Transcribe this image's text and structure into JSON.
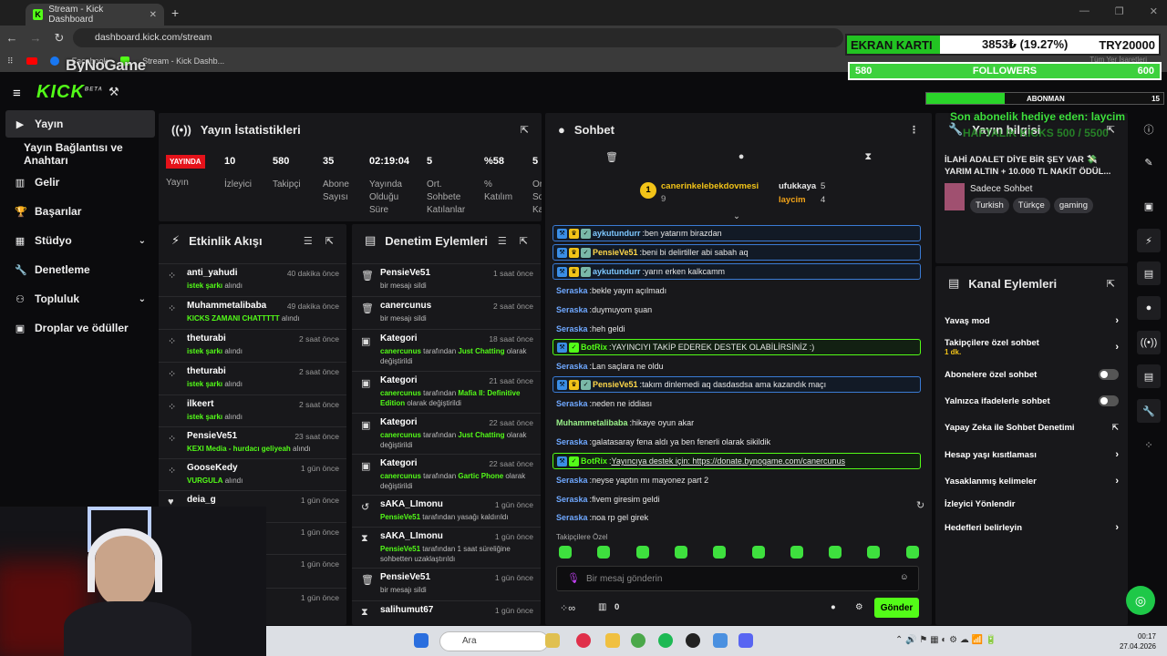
{
  "browser": {
    "tab_title": "Stream - Kick Dashboard",
    "url": "dashboard.kick.com/stream",
    "bookmarks": [
      "Facebook",
      "Stream - Kick Dashb..."
    ],
    "all_bookmarks": "Tüm Yer İşaretleri"
  },
  "overlay": {
    "logo": "ByNoGame",
    "ekran_label": "EKRAN KARTI",
    "ekran_value": "3853₺ (19.27%)",
    "ekran_goal": "TRY20000",
    "followers_left": "580",
    "followers_label": "FOLLOWERS",
    "followers_right": "600",
    "followers_progress": 0.97,
    "abonman_label": "ABONMAN",
    "abonman_value": "15",
    "last_sub": "Son abonelik hediye eden: laycim",
    "weekly": "HAFTALIK KICKS 500 / 5500"
  },
  "nav": {
    "items": [
      {
        "label": "Yayın"
      },
      {
        "label": "Yayın Bağlantısı ve Anahtarı"
      },
      {
        "label": "Gelir"
      },
      {
        "label": "Başarılar"
      },
      {
        "label": "Stüdyo"
      },
      {
        "label": "Denetleme"
      },
      {
        "label": "Topluluk"
      },
      {
        "label": "Droplar ve ödüller"
      }
    ]
  },
  "stats": {
    "title": "Yayın İstatistikleri",
    "live": "YAYINDA",
    "status": "Yayın",
    "viewers_v": "10",
    "viewers_l": "İzleyici",
    "followers_v": "580",
    "followers_l": "Takipçi",
    "subs_v": "35",
    "subs_l": "Abone Sayısı",
    "time_v": "02:19:04",
    "time_l": "Yayında Olduğu Süre",
    "avg_v": "5",
    "avg_l": "Ort. Sohbete Katılanlar",
    "pct_v": "%58",
    "pct_l": "% Katılım",
    "last_v": "5",
    "last_l": "Or So Ka"
  },
  "feed": {
    "title": "Etkinlik Akışı",
    "items": [
      {
        "name": "anti_yahudi",
        "time": "40 dakika önce",
        "g": "istek şarkı",
        "s": " alındı"
      },
      {
        "name": "Muhammetalibaba",
        "time": "49 dakika önce",
        "g": "KICKS ZAMANI CHATTTTT",
        "s": " alındı"
      },
      {
        "name": "theturabi",
        "time": "2 saat önce",
        "g": "istek şarkı",
        "s": " alındı"
      },
      {
        "name": "theturabi",
        "time": "2 saat önce",
        "g": "istek şarkı",
        "s": " alındı"
      },
      {
        "name": "ilkeert",
        "time": "2 saat önce",
        "g": "istek şarkı",
        "s": " alındı"
      },
      {
        "name": "PensieVe51",
        "time": "23 saat önce",
        "g": "KEXI Media - hurdacı geliyeah",
        "s": " alındı"
      },
      {
        "name": "GooseKedy",
        "time": "1 gün önce",
        "g": "VURGULA",
        "s": " alındı"
      },
      {
        "name": "deia_g",
        "time": "1 gün önce",
        "g": "",
        "s": ""
      },
      {
        "name": "",
        "time": "1 gün önce",
        "g": "",
        "s": ""
      },
      {
        "name": "",
        "time": "1 gün önce",
        "g": "",
        "s": ""
      },
      {
        "name": "",
        "time": "1 gün önce",
        "g": "TTTT",
        "s": " alındı"
      }
    ]
  },
  "mod": {
    "title": "Denetim Eylemleri",
    "items": [
      {
        "name": "PensieVe51",
        "time": "1 saat önce",
        "s": "bir mesajı sildi"
      },
      {
        "name": "canercunus",
        "time": "2 saat önce",
        "s": "bir mesajı sildi"
      },
      {
        "name": "Kategori",
        "time": "18 saat önce",
        "g1": "canercunus",
        "m": " tarafından ",
        "g2": "Just Chatting",
        "e": " olarak değiştirildi"
      },
      {
        "name": "Kategori",
        "time": "21 saat önce",
        "g1": "canercunus",
        "m": " tarafından ",
        "g2": "Mafia II: Definitive Edition",
        "e": " olarak değiştirildi"
      },
      {
        "name": "Kategori",
        "time": "22 saat önce",
        "g1": "canercunus",
        "m": " tarafından ",
        "g2": "Just Chatting",
        "e": " olarak değiştirildi"
      },
      {
        "name": "Kategori",
        "time": "22 saat önce",
        "g1": "canercunus",
        "m": " tarafından ",
        "g2": "Gartic Phone",
        "e": " olarak değiştirildi"
      },
      {
        "name": "sAKA_LImonu",
        "time": "1 gün önce",
        "g1": "PensieVe51",
        "m": " tarafından yasağı kaldırıldı",
        "g2": "",
        "e": ""
      },
      {
        "name": "sAKA_LImonu",
        "time": "1 gün önce",
        "g1": "PensieVe51",
        "m": " tarafından 1 saat süreliğine sohbetten uzaklaştırıldı",
        "g2": "",
        "e": ""
      },
      {
        "name": "PensieVe51",
        "time": "1 gün önce",
        "s": "bir mesajı sildi"
      },
      {
        "name": "salihumut67",
        "time": "1 gün önce",
        "s": ""
      }
    ]
  },
  "chat": {
    "title": "Sohbet",
    "lb1_name": "canerinkelebekdovmesi",
    "lb1_val": "9",
    "lb2_name": "ufukkaya",
    "lb2_val": "5",
    "lb3_name": "laycim",
    "lb3_val": "4",
    "lb_rank": "1",
    "messages": [
      {
        "u": "aykutundurr",
        "c": "#7ec8ff",
        "t": "ben yatarım birazdan",
        "hl": "b"
      },
      {
        "u": "PensieVe51",
        "c": "#ffd84a",
        "t": "beni bi delirtiller abi sabah aq",
        "hl": "b"
      },
      {
        "u": "aykutundurr",
        "c": "#7ec8ff",
        "t": "yarın erken kalkcamm",
        "hl": "b"
      },
      {
        "u": "Seraska",
        "c": "#6fa8ff",
        "t": "bekle yayın açılmadı",
        "hl": ""
      },
      {
        "u": "Seraska",
        "c": "#6fa8ff",
        "t": "duymuyom şuan",
        "hl": ""
      },
      {
        "u": "Seraska",
        "c": "#6fa8ff",
        "t": "heh geldi",
        "hl": ""
      },
      {
        "u": "BotRix",
        "c": "#53fc18",
        "t": "YAYINCIYI TAKİP EDEREK DESTEK OLABİLİRSİNİZ :)",
        "hl": "g"
      },
      {
        "u": "Seraska",
        "c": "#6fa8ff",
        "t": "Lan saçlara ne oldu",
        "hl": ""
      },
      {
        "u": "PensieVe51",
        "c": "#ffd84a",
        "t": "takım dinlemedi aq dasdasdsa ama kazandık maçı",
        "hl": "b"
      },
      {
        "u": "Seraska",
        "c": "#6fa8ff",
        "t": "neden ne iddiası",
        "hl": ""
      },
      {
        "u": "Muhammetalibaba",
        "c": "#9af28a",
        "t": "hikaye oyun akar",
        "hl": ""
      },
      {
        "u": "Seraska",
        "c": "#6fa8ff",
        "t": "galatasaray fena aldı ya ben fenerli olarak sikildik",
        "hl": ""
      },
      {
        "u": "BotRix",
        "c": "#53fc18",
        "t": "Yayıncıya destek için: https://donate.bynogame.com/canercunus",
        "hl": "g"
      },
      {
        "u": "Seraska",
        "c": "#6fa8ff",
        "t": "neyse yaptın mı mayonez part 2",
        "hl": ""
      },
      {
        "u": "Seraska",
        "c": "#6fa8ff",
        "t": "fivem giresim geldi",
        "hl": ""
      },
      {
        "u": "Seraska",
        "c": "#6fa8ff",
        "t": "noa rp gel girek",
        "hl": ""
      }
    ],
    "followers_only": "Takipçilere Özel",
    "placeholder": "Bir mesaj gönderin",
    "count": "0",
    "send": "Gönder"
  },
  "info": {
    "title": "Yayın bilgisi",
    "stream_title": "İLAHİ ADALET DİYE BİR ŞEY VAR 💸 YARIM ALTIN + 10.000 TL NAKİT ÖDÜL...",
    "category": "Sadece Sohbet",
    "tags": [
      "Turkish",
      "Türkçe",
      "gaming"
    ]
  },
  "actions": {
    "title": "Kanal Eylemleri",
    "items": [
      {
        "label": "Yavaş mod",
        "type": "chev"
      },
      {
        "label": "Takipçilere özel sohbet",
        "sub": "1 dk.",
        "type": "chev"
      },
      {
        "label": "Abonelere özel sohbet",
        "type": "toggle"
      },
      {
        "label": "Yalnızca ifadelerle sohbet",
        "type": "toggle"
      },
      {
        "label": "Yapay Zeka ile Sohbet Denetimi",
        "type": "ext"
      },
      {
        "label": "Hesap yaşı kısıtlaması",
        "type": "chev"
      },
      {
        "label": "Yasaklanmış kelimeler",
        "type": "chev"
      },
      {
        "label": "İzleyici Yönlendir",
        "type": ""
      },
      {
        "label": "Hedefleri belirleyin",
        "type": "chev"
      }
    ]
  },
  "taskbar": {
    "search": "Ara",
    "time": "00:17",
    "date": "27.04.2026"
  }
}
